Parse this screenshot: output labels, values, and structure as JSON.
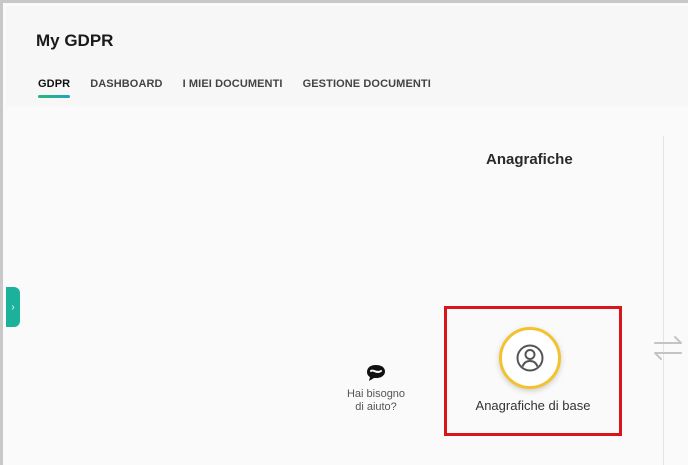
{
  "app": {
    "title": "My GDPR"
  },
  "tabs": [
    {
      "label": "GDPR",
      "active": true
    },
    {
      "label": "DASHBOARD",
      "active": false
    },
    {
      "label": "I MIEI DOCUMENTI",
      "active": false
    },
    {
      "label": "GESTIONE DOCUMENTI",
      "active": false
    }
  ],
  "section": {
    "title": "Anagrafiche"
  },
  "card": {
    "label": "Anagrafiche di base",
    "icon": "user-circle-icon"
  },
  "help": {
    "line1": "Hai bisogno",
    "line2": "di aiuto?",
    "icon": "help-chat-icon"
  },
  "colors": {
    "accent_green": "#2bb673",
    "highlight_red": "#d9141b",
    "icon_ring": "#f2c230",
    "side_tab": "#1bb19a"
  }
}
